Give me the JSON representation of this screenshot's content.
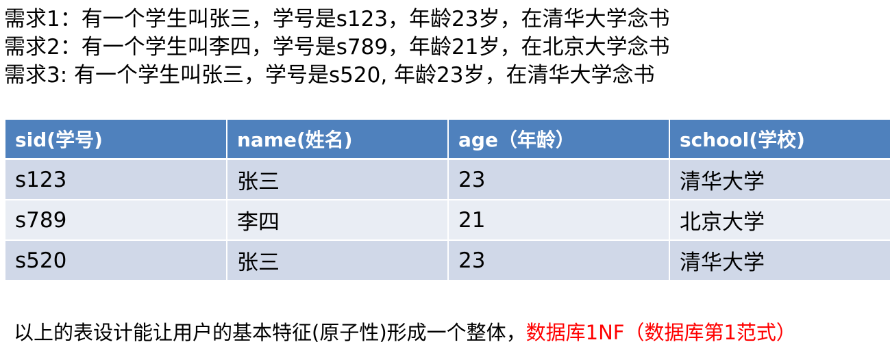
{
  "requirements": [
    "需求1：有一个学生叫张三，学号是s123，年龄23岁，在清华大学念书",
    "需求2：有一个学生叫李四，学号是s789，年龄21岁，在北京大学念书",
    "需求3:   有一个学生叫张三，学号是s520, 年龄23岁，在清华大学念书"
  ],
  "table": {
    "headers": [
      "sid(学号)",
      "name(姓名)",
      "age（年龄）",
      "school(学校)"
    ],
    "rows": [
      [
        "s123",
        "张三",
        "23",
        "清华大学"
      ],
      [
        "s789",
        "李四",
        "21",
        "北京大学"
      ],
      [
        "s520",
        "张三",
        "23",
        "清华大学"
      ]
    ]
  },
  "conclusion": {
    "text": "以上的表设计能让用户的基本特征(原子性)形成一个整体，",
    "highlight": "数据库1NF（数据库第1范式）"
  },
  "colors": {
    "header_bg": "#4f81bd",
    "row_odd_bg": "#d0d8e8",
    "row_even_bg": "#e9edf4",
    "highlight": "#ff0000"
  }
}
